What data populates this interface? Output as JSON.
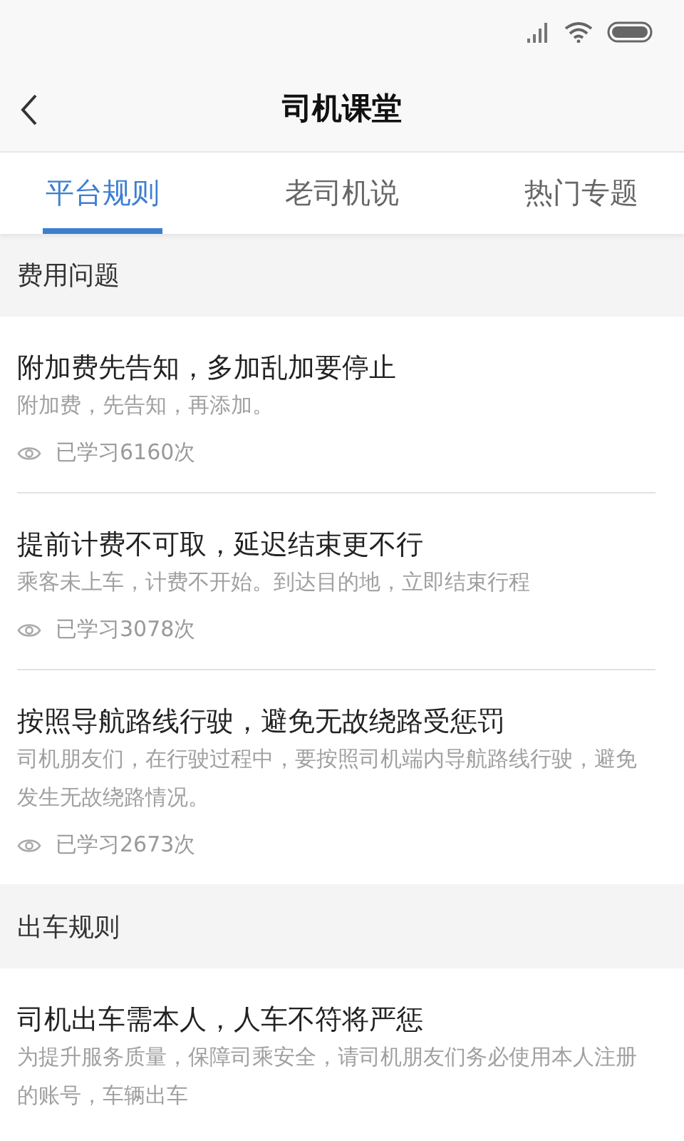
{
  "header": {
    "title": "司机课堂"
  },
  "tabs": [
    {
      "label": "平台规则",
      "selected": true
    },
    {
      "label": "老司机说",
      "selected": false
    },
    {
      "label": "热门专题",
      "selected": false
    }
  ],
  "sections": [
    {
      "title": "费用问题",
      "items": [
        {
          "title": "附加费先告知，多加乱加要停止",
          "summary": "附加费，先告知，再添加。",
          "views": "已学习6160次"
        },
        {
          "title": "提前计费不可取，延迟结束更不行",
          "summary": "乘客未上车，计费不开始。到达目的地，立即结束行程",
          "views": "已学习3078次"
        },
        {
          "title": "按照导航路线行驶，避免无故绕路受惩罚",
          "summary": "司机朋友们，在行驶过程中，要按照司机端内导航路线行驶，避免发生无故绕路情况。",
          "views": "已学习2673次"
        }
      ]
    },
    {
      "title": "出车规则",
      "items": [
        {
          "title": "司机出车需本人，人车不符将严惩",
          "summary": "为提升服务质量，保障司乘安全，请司机朋友们务必使用本人注册的账号，车辆出车"
        }
      ]
    }
  ]
}
